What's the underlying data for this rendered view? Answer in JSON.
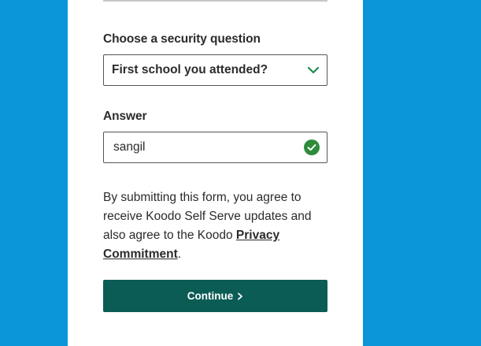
{
  "question": {
    "label": "Choose a security question",
    "selected": "First school you attended?"
  },
  "answer": {
    "label": "Answer",
    "value": "sangil",
    "status": "valid"
  },
  "disclaimer": {
    "text": "By submitting this form, you agree to receive Koodo Self Serve updates and also agree to the Koodo ",
    "link": "Privacy Commitment",
    "suffix": "."
  },
  "continue_label": "Continue",
  "icons": {
    "select_chevron": "chevron-down-icon",
    "valid_check": "check-circle-icon",
    "button_chevron": "chevron-right-icon"
  },
  "colors": {
    "background": "#0a96d9",
    "card": "#ffffff",
    "button": "#0b5c55",
    "chevron": "#1e8c50",
    "check": "#2e8b3c"
  }
}
